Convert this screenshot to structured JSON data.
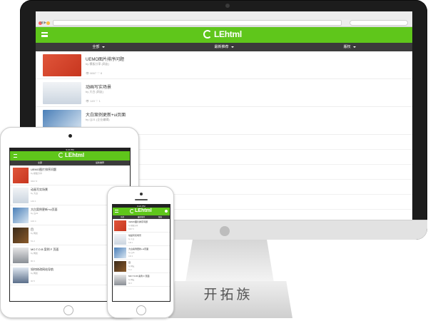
{
  "site": {
    "brand_color": "#5fc61b",
    "logo_text": "LEhtml",
    "filters": [
      "全部",
      "最新推荐",
      "版权"
    ]
  },
  "desktop": {
    "items": [
      {
        "title": "UEMO图片排序问题",
        "meta": "by 模板分享 (网友)",
        "stats": "👁 6667   ♡ 8"
      },
      {
        "title": "动画写实场景",
        "meta": "by 大白 (网友)",
        "stats": "👁 149   ♡ 1"
      },
      {
        "title": "大白案例更新+ui页面",
        "meta": "by 山21 (企业编辑)",
        "stats": ""
      }
    ]
  },
  "tablet": {
    "status": "9:21 PM",
    "items": [
      {
        "title": "UEMO图片排序问题",
        "meta": "by 模板分享",
        "stats": "6667  8"
      },
      {
        "title": "动画写实场景",
        "meta": "by 大白",
        "stats": "149  1"
      },
      {
        "title": "大白案例更新+ui页面",
        "meta": "by 山21",
        "stats": "100  4"
      },
      {
        "title": "目",
        "meta": "by 网友",
        "stats": "51  2"
      },
      {
        "title": "MO.T.O.B 案例 F 页面",
        "meta": "by 网友",
        "stats": "80  3"
      },
      {
        "title": "如何修改网站导航",
        "meta": "by 网友",
        "stats": "90  5"
      }
    ]
  },
  "phone": {
    "status": "9:21 PM",
    "items": [
      {
        "title": "UEMO图片排序问题",
        "meta": "by 模板分享",
        "stats": "6667  8"
      },
      {
        "title": "动画写实场景",
        "meta": "by 大白",
        "stats": "149  1"
      },
      {
        "title": "大白案例更新+ui页面",
        "meta": "by 山21",
        "stats": "100  4"
      },
      {
        "title": "目",
        "meta": "by 网友",
        "stats": "51  2"
      },
      {
        "title": "MO.T.O.B 案例 F 页面",
        "meta": "by 网友",
        "stats": "80  3"
      }
    ]
  },
  "stand_text": "开拓族"
}
